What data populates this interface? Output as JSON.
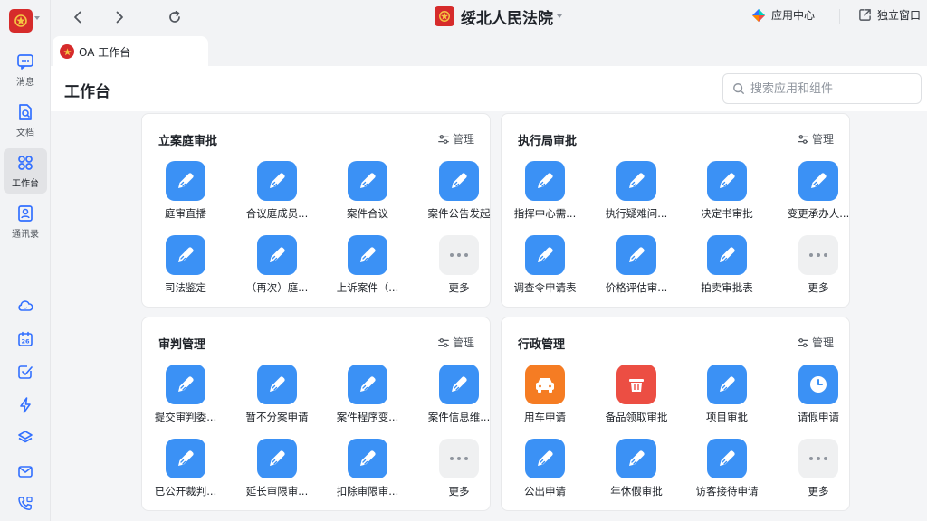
{
  "window": {
    "org_title": "绥北人民法院",
    "app_center_label": "应用中心",
    "standalone_label": "独立窗口"
  },
  "nav": [
    {
      "label": "消息",
      "icon": "message-icon"
    },
    {
      "label": "文档",
      "icon": "document-icon"
    },
    {
      "label": "工作台",
      "icon": "workbench-icon"
    },
    {
      "label": "通讯录",
      "icon": "contacts-icon"
    }
  ],
  "calendar_day": "26",
  "tools": [
    "cloud-icon",
    "calendar-icon",
    "task-check-icon",
    "lightning-icon",
    "layers-icon",
    "mail-icon",
    "phone-meeting-icon"
  ],
  "tab": {
    "label": "OA 工作台"
  },
  "page": {
    "title": "工作台",
    "search_placeholder": "搜索应用和组件"
  },
  "manage_label": "管理",
  "cards": [
    {
      "title": "立案庭审批",
      "apps": [
        {
          "label": "庭审直播",
          "color": "blue"
        },
        {
          "label": "合议庭成员...",
          "color": "blue"
        },
        {
          "label": "案件合议",
          "color": "blue"
        },
        {
          "label": "案件公告发起",
          "color": "blue"
        },
        {
          "label": "司法鉴定",
          "color": "blue"
        },
        {
          "label": "（再次）庭...",
          "color": "blue"
        },
        {
          "label": "上诉案件（...",
          "color": "blue"
        },
        {
          "label": "更多",
          "color": "more"
        }
      ]
    },
    {
      "title": "执行局审批",
      "apps": [
        {
          "label": "指挥中心需...",
          "color": "blue"
        },
        {
          "label": "执行疑难问...",
          "color": "blue"
        },
        {
          "label": "决定书审批",
          "color": "blue"
        },
        {
          "label": "变更承办人...",
          "color": "blue"
        },
        {
          "label": "调查令申请表",
          "color": "blue"
        },
        {
          "label": "价格评估审...",
          "color": "blue"
        },
        {
          "label": "拍卖审批表",
          "color": "blue"
        },
        {
          "label": "更多",
          "color": "more"
        }
      ]
    },
    {
      "title": "审判管理",
      "apps": [
        {
          "label": "提交审判委...",
          "color": "blue"
        },
        {
          "label": "暂不分案申请",
          "color": "blue"
        },
        {
          "label": "案件程序变...",
          "color": "blue"
        },
        {
          "label": "案件信息维...",
          "color": "blue"
        },
        {
          "label": "已公开裁判...",
          "color": "blue"
        },
        {
          "label": "延长审限审...",
          "color": "blue"
        },
        {
          "label": "扣除审限审...",
          "color": "blue"
        },
        {
          "label": "更多",
          "color": "more"
        }
      ]
    },
    {
      "title": "行政管理",
      "apps": [
        {
          "label": "用车申请",
          "color": "orange",
          "icon": "car-icon"
        },
        {
          "label": "备品领取审批",
          "color": "red",
          "icon": "basket-icon"
        },
        {
          "label": "项目审批",
          "color": "blue"
        },
        {
          "label": "请假申请",
          "color": "blue",
          "icon": "clock-icon"
        },
        {
          "label": "公出申请",
          "color": "blue"
        },
        {
          "label": "年休假审批",
          "color": "blue"
        },
        {
          "label": "访客接待申请",
          "color": "blue"
        },
        {
          "label": "更多",
          "color": "more"
        }
      ]
    }
  ]
}
